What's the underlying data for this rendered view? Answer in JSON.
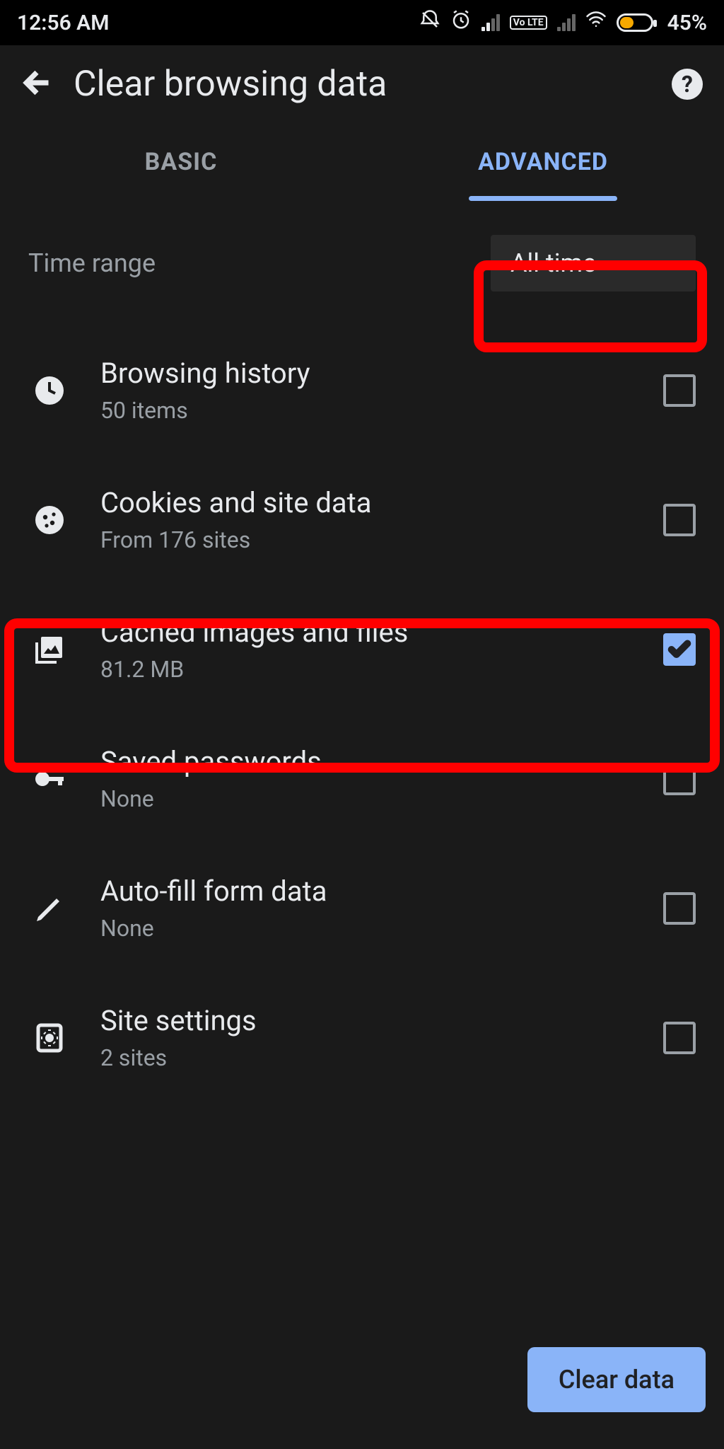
{
  "status": {
    "time": "12:56 AM",
    "battery_pct": "45%",
    "volte": "Vo LTE"
  },
  "header": {
    "title": "Clear browsing data"
  },
  "tabs": {
    "basic": "BASIC",
    "advanced": "ADVANCED",
    "active": "advanced"
  },
  "time_range": {
    "label": "Time range",
    "selected": "All time"
  },
  "options": {
    "browsing_history": {
      "title": "Browsing history",
      "subtitle": "50 items",
      "checked": false
    },
    "cookies": {
      "title": "Cookies and site data",
      "subtitle": "From 176 sites",
      "checked": false
    },
    "cache": {
      "title": "Cached images and files",
      "subtitle": "81.2 MB",
      "checked": true
    },
    "passwords": {
      "title": "Saved passwords",
      "subtitle": "None",
      "checked": false
    },
    "autofill": {
      "title": "Auto-fill form data",
      "subtitle": "None",
      "checked": false
    },
    "site_settings": {
      "title": "Site settings",
      "subtitle": "2 sites",
      "checked": false
    }
  },
  "footer": {
    "clear_button": "Clear data"
  },
  "colors": {
    "accent": "#8ab4f8",
    "highlight": "#ff0000",
    "battery_fill": "#f7a900"
  }
}
